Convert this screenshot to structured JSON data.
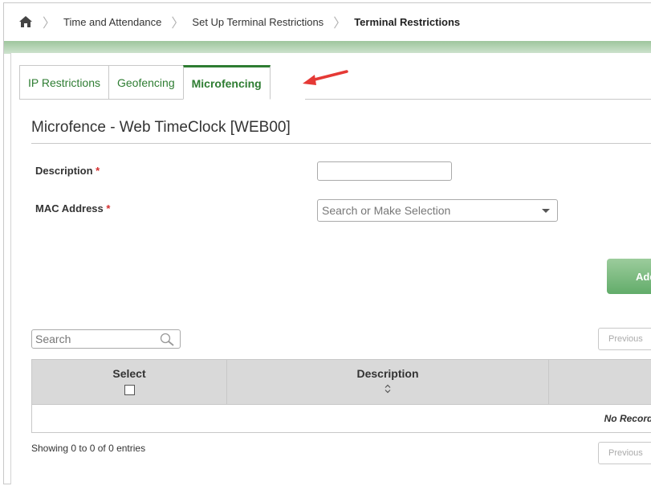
{
  "breadcrumb": {
    "items": [
      "Time and Attendance",
      "Set Up Terminal Restrictions",
      "Terminal Restrictions"
    ]
  },
  "tabs": [
    {
      "label": "IP Restrictions"
    },
    {
      "label": "Geofencing"
    },
    {
      "label": "Microfencing"
    }
  ],
  "page_title": "Microfence - Web TimeClock [WEB00]",
  "form": {
    "description_label": "Description",
    "mac_label": "MAC Address",
    "required_mark": "*",
    "description_value": "",
    "mac_placeholder": "Search or Make Selection"
  },
  "add_button_label": "Add",
  "table": {
    "search_placeholder": "Search",
    "previous_label": "Previous",
    "columns": [
      "Select",
      "Description"
    ],
    "empty_message": "No Records",
    "info": "Showing 0 to 0 of 0 entries"
  },
  "colors": {
    "accent": "#2e7d32",
    "arrow": "#e53935",
    "green_bar": "#9fc69d"
  },
  "icons": [
    "home-icon",
    "chevron-right-icon",
    "search-icon",
    "sort-icon",
    "caret-down-icon",
    "arrow-annotation-icon"
  ]
}
